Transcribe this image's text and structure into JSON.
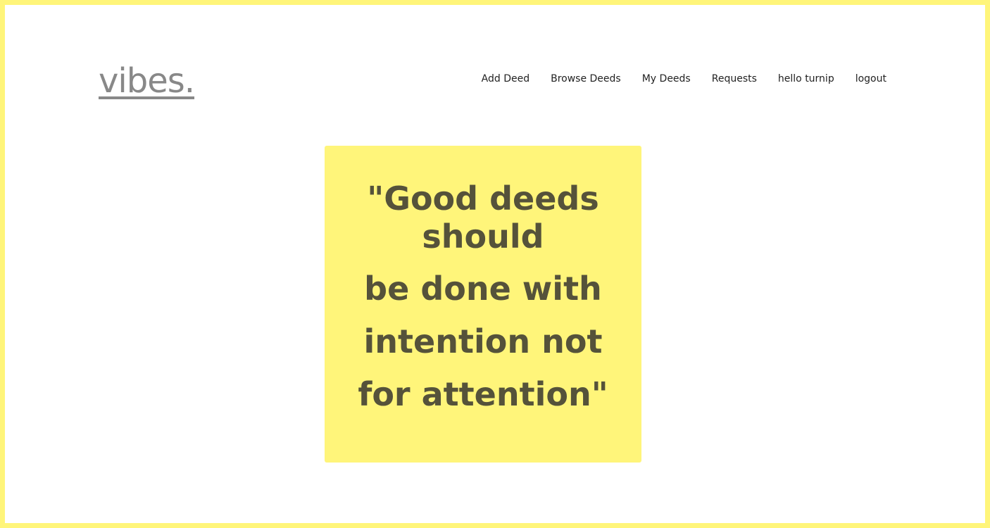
{
  "logo": "vibes.",
  "nav": [
    "Add Deed",
    "Browse Deeds",
    "My Deeds",
    "Requests",
    "hello turnip",
    "logout"
  ],
  "quote": {
    "line1": "\"Good deeds should",
    "line2": "be done with intention not for attention\""
  },
  "colors": {
    "accent": "#fff57a",
    "text": "#55523a",
    "logo": "#888888"
  }
}
